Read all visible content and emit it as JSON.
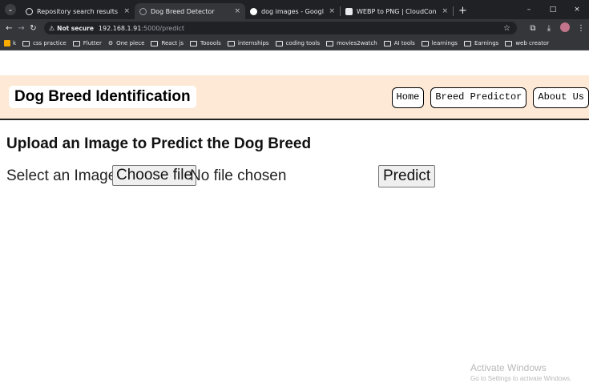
{
  "browser": {
    "tabs": [
      {
        "title": "Repository search results",
        "icon": "github-icon",
        "active": false
      },
      {
        "title": "Dog Breed Detector",
        "icon": "globe-icon",
        "active": true
      },
      {
        "title": "dog images - Google Search",
        "icon": "google-icon",
        "active": false
      },
      {
        "title": "WEBP to PNG | CloudConvert",
        "icon": "cloudconvert-icon",
        "active": false
      }
    ],
    "new_tab": "+",
    "window_controls": {
      "minimize": "–",
      "restore": "□",
      "close": "×"
    },
    "nav": {
      "back": "←",
      "forward": "→",
      "reload": "↻"
    },
    "address": {
      "security_label": "Not secure",
      "host": "192.168.1.91",
      "path": ":5000/predict"
    },
    "bookmarks": [
      "k",
      "css practice",
      "Flutter",
      "One piece",
      "React js",
      "Tooools",
      "internships",
      "coding tools",
      "movies2watch",
      "AI tools",
      "learnings",
      "Earnings",
      "web creator"
    ]
  },
  "site": {
    "brand": "Dog Breed Identification",
    "nav": [
      "Home",
      "Breed Predictor",
      "About Us"
    ],
    "header_bg": "#fde9d5"
  },
  "main": {
    "title": "Upload an Image to Predict the Dog Breed",
    "select_label": "Select an Image:",
    "choose_button": "Choose file",
    "no_file_text": "No file chosen",
    "predict_button": "Predict"
  },
  "watermark": {
    "line1": "Activate Windows",
    "line2": "Go to Settings to activate Windows."
  }
}
